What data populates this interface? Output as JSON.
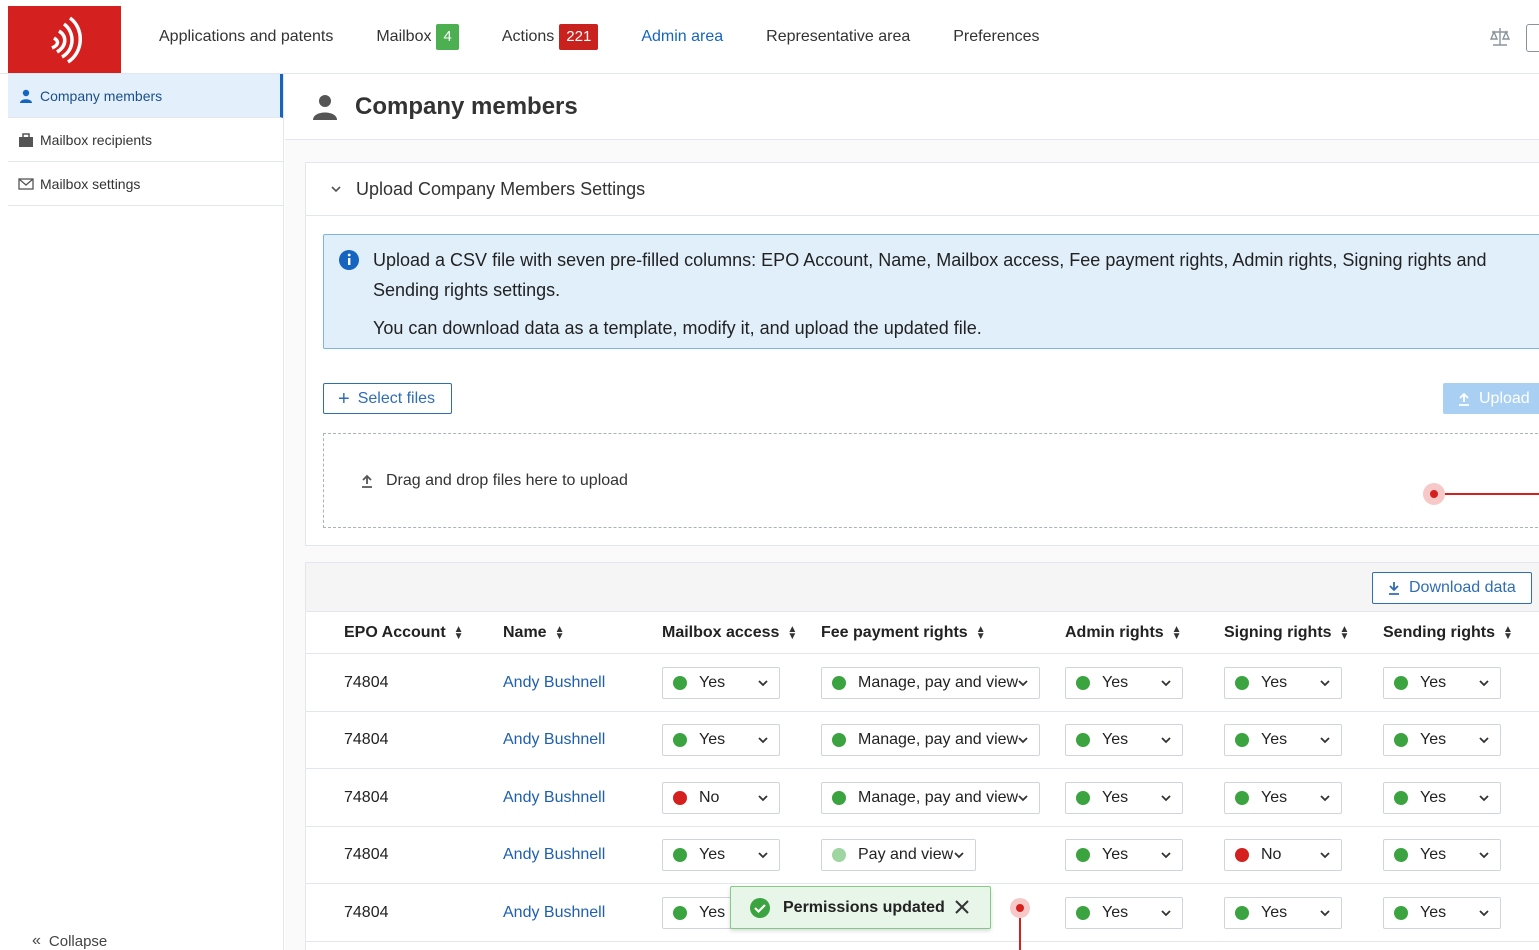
{
  "nav": {
    "items": [
      {
        "label": "Applications and patents"
      },
      {
        "label": "Mailbox",
        "badge": "4"
      },
      {
        "label": "Actions",
        "badge": "221"
      },
      {
        "label": "Admin area",
        "active": true
      },
      {
        "label": "Representative area"
      },
      {
        "label": "Preferences"
      }
    ]
  },
  "sidebar": {
    "items": [
      {
        "label": "Company members",
        "icon": "person-icon",
        "active": true
      },
      {
        "label": "Mailbox recipients",
        "icon": "briefcase-icon"
      },
      {
        "label": "Mailbox settings",
        "icon": "envelope-icon"
      }
    ],
    "collapse_label": "Collapse"
  },
  "page": {
    "title": "Company members"
  },
  "upload": {
    "section_title": "Upload Company Members Settings",
    "info_line1": "Upload a CSV file with seven pre-filled columns: EPO Account, Name, Mailbox access, Fee payment rights, Admin rights, Signing rights and",
    "info_line2": "Sending rights settings.",
    "info_line3": "You can download data as a template, modify it, and upload the updated file.",
    "select_files_label": "Select files",
    "upload_label": "Upload",
    "dropzone_text": "Drag and drop files here to upload"
  },
  "table": {
    "download_label": "Download data",
    "columns": [
      "EPO Account",
      "Name",
      "Mailbox access",
      "Fee payment rights",
      "Admin rights",
      "Signing rights",
      "Sending rights"
    ],
    "rows": [
      {
        "account": "74804",
        "name": "Andy Bushnell",
        "mailbox": "Yes",
        "mailbox_status": "green",
        "fee": "Manage, pay and view",
        "fee_status": "green",
        "admin": "Yes",
        "admin_status": "green",
        "signing": "Yes",
        "signing_status": "green",
        "sending": "Yes",
        "sending_status": "green"
      },
      {
        "account": "74804",
        "name": "Andy Bushnell",
        "mailbox": "Yes",
        "mailbox_status": "green",
        "fee": "Manage, pay and view",
        "fee_status": "green",
        "admin": "Yes",
        "admin_status": "green",
        "signing": "Yes",
        "signing_status": "green",
        "sending": "Yes",
        "sending_status": "green"
      },
      {
        "account": "74804",
        "name": "Andy Bushnell",
        "mailbox": "No",
        "mailbox_status": "red",
        "fee": "Manage, pay and view",
        "fee_status": "green",
        "admin": "Yes",
        "admin_status": "green",
        "signing": "Yes",
        "signing_status": "green",
        "sending": "Yes",
        "sending_status": "green"
      },
      {
        "account": "74804",
        "name": "Andy Bushnell",
        "mailbox": "Yes",
        "mailbox_status": "green",
        "fee": "Pay and view",
        "fee_status": "light",
        "admin": "Yes",
        "admin_status": "green",
        "signing": "No",
        "signing_status": "red",
        "sending": "Yes",
        "sending_status": "green"
      },
      {
        "account": "74804",
        "name": "Andy Bushnell",
        "mailbox": "Yes",
        "mailbox_status": "green",
        "fee": "",
        "fee_status": "",
        "admin": "Yes",
        "admin_status": "green",
        "signing": "Yes",
        "signing_status": "green",
        "sending": "Yes",
        "sending_status": "green"
      }
    ]
  },
  "toast": {
    "message": "Permissions updated"
  },
  "colors": {
    "brand": "#d4201f",
    "accent": "#1565c0",
    "success": "#3ba33f",
    "danger": "#d4201f"
  }
}
